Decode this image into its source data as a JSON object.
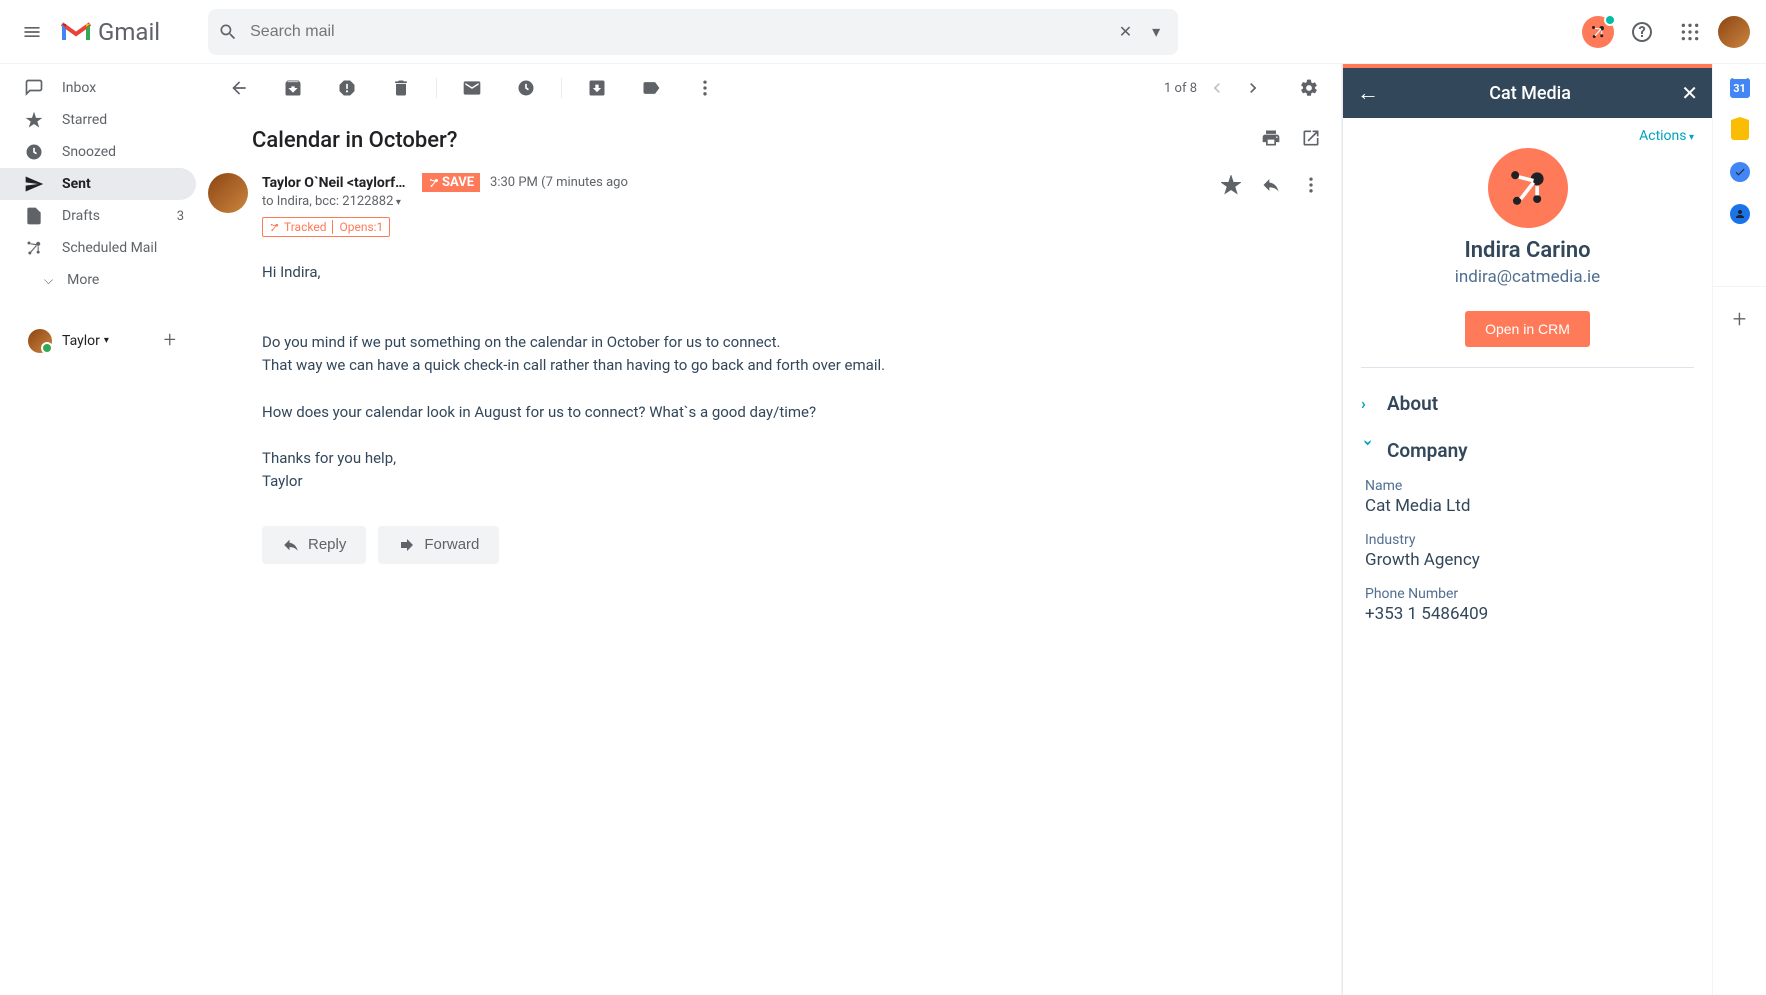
{
  "app": {
    "name": "Gmail"
  },
  "search": {
    "placeholder": "Search mail"
  },
  "sidebar": {
    "items": [
      {
        "label": "Inbox",
        "count": ""
      },
      {
        "label": "Starred",
        "count": ""
      },
      {
        "label": "Snoozed",
        "count": ""
      },
      {
        "label": "Sent",
        "count": ""
      },
      {
        "label": "Drafts",
        "count": "3"
      },
      {
        "label": "Scheduled Mail",
        "count": ""
      }
    ],
    "more": "More",
    "profile": "Taylor"
  },
  "toolbar": {
    "pager": "1 of 8"
  },
  "message": {
    "subject": "Calendar in October?",
    "from": "Taylor O`Neil <taylorfo...",
    "save": "SAVE",
    "time": "3:30 PM (7 minutes ago",
    "to": "to Indira, bcc: 2122882",
    "tracked": "Tracked",
    "opens": "Opens:1",
    "body_greeting": "Hi Indira,",
    "body_l1": "Do you mind if we put something on the calendar in October for us to connect.",
    "body_l2": "That way we can have a quick check-in call rather than having to go back and forth over email.",
    "body_l3": "How does your calendar look in August for us to connect? What`s a good day/time?",
    "body_l4": "Thanks for you help,",
    "body_sig": "Taylor",
    "reply": "Reply",
    "forward": "Forward"
  },
  "hubspot": {
    "title": "Cat Media",
    "actions": "Actions",
    "contact_name": "Indira Carino",
    "contact_email": "indira@catmedia.ie",
    "crm_btn": "Open in CRM",
    "sections": {
      "about": "About",
      "company": "Company"
    },
    "company": {
      "name_label": "Name",
      "name_value": "Cat Media Ltd",
      "industry_label": "Industry",
      "industry_value": "Growth Agency",
      "phone_label": "Phone Number",
      "phone_value": "+353 1 5486409"
    }
  },
  "rail": {
    "cal_day": "31"
  }
}
